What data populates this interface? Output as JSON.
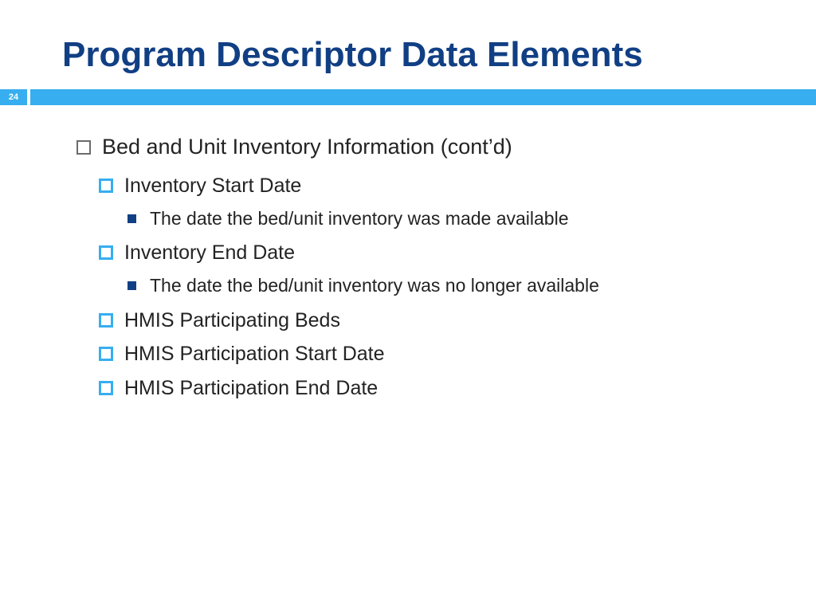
{
  "title": "Program Descriptor Data Elements",
  "page_number": "24",
  "bullets": {
    "l1_0": "Bed and Unit Inventory Information (cont’d)",
    "l2_0": "Inventory Start Date",
    "l3_0": "The date the bed/unit inventory was made available",
    "l2_1": "Inventory End Date",
    "l3_1": "The date the bed/unit inventory was no longer available",
    "l2_2": "HMIS Participating Beds",
    "l2_3": "HMIS Participation Start Date",
    "l2_4": "HMIS Participation End Date"
  }
}
